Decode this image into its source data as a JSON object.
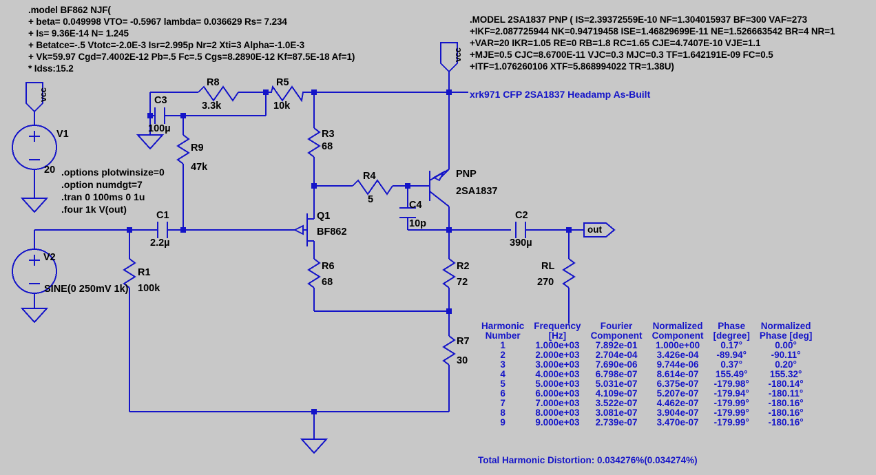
{
  "netlist": {
    "jfet_model": [
      ".model BF862 NJF(",
      "+ beta= 0.049998 VTO= -0.5967 lambda= 0.036629 Rs= 7.234",
      "+ Is= 9.36E-14 N= 1.245",
      "+ Betatce=-.5 Vtotc=-2.0E-3 Isr=2.995p Nr=2 Xti=3 Alpha=-1.0E-3",
      "+ Vk=59.97 Cgd=7.4002E-12 Pb=.5 Fc=.5 Cgs=8.2890E-12 Kf=87.5E-18 Af=1)",
      "* Idss:15.2"
    ],
    "pnp_model": [
      ".MODEL 2SA1837 PNP ( IS=2.39372559E-10 NF=1.304015937 BF=300 VAF=273",
      "+IKF=2.087725944 NK=0.94719458 ISE=1.46829699E-11 NE=1.526663542 BR=4 NR=1",
      "+VAR=20 IKR=1.05 RE=0 RB=1.8 RC=1.65 CJE=4.7407E-10 VJE=1.1",
      "+MJE=0.5 CJC=8.6700E-11 VJC=0.3 MJC=0.3 TF=1.642191E-09 FC=0.5",
      "+ITF=1.076260106 XTF=5.868994022 TR=1.38U)"
    ],
    "directives": [
      ".options plotwinsize=0",
      ".option numdgt=7",
      ".tran 0 100ms 0 1u",
      ".four 1k V(out)"
    ]
  },
  "title": "xrk971 CFP 2SA1837 Headamp As-Built",
  "colors": {
    "wire": "#1414c8",
    "text": "#000000",
    "title": "#1414c8",
    "background": "#c8c8c8"
  },
  "labels": {
    "vcc_top_left": "vcc",
    "vcc_top_right": "vcc",
    "out": "out"
  },
  "components": {
    "V1": {
      "ref": "V1",
      "value": "20"
    },
    "V2": {
      "ref": "V2",
      "value": "SINE(0 250mV 1k)"
    },
    "C3": {
      "ref": "C3",
      "value": "100µ"
    },
    "C1": {
      "ref": "C1",
      "value": "2.2µ"
    },
    "C4": {
      "ref": "C4",
      "value": "10p"
    },
    "C2": {
      "ref": "C2",
      "value": "390µ"
    },
    "R8": {
      "ref": "R8",
      "value": "3.3k"
    },
    "R5": {
      "ref": "R5",
      "value": "10k"
    },
    "R9": {
      "ref": "R9",
      "value": "47k"
    },
    "R3": {
      "ref": "R3",
      "value": "68"
    },
    "R4": {
      "ref": "R4",
      "value": "5"
    },
    "R1": {
      "ref": "R1",
      "value": "100k"
    },
    "R6": {
      "ref": "R6",
      "value": "68"
    },
    "R2": {
      "ref": "R2",
      "value": "72"
    },
    "R7": {
      "ref": "R7",
      "value": "30"
    },
    "RL": {
      "ref": "RL",
      "value": "270"
    },
    "Q1": {
      "ref": "Q1",
      "value": "BF862"
    },
    "Q2": {
      "ref": "PNP",
      "value": "2SA1837"
    }
  },
  "fourier": {
    "headers": [
      [
        "Harmonic",
        "Number"
      ],
      [
        "Frequency",
        "[Hz]"
      ],
      [
        "Fourier",
        "Component"
      ],
      [
        "Normalized",
        "Component"
      ],
      [
        "Phase",
        "[degree]"
      ],
      [
        "Normalized",
        "Phase [deg]"
      ]
    ],
    "rows": [
      [
        "1",
        "1.000e+03",
        "7.892e-01",
        "1.000e+00",
        "0.17°",
        "0.00°"
      ],
      [
        "2",
        "2.000e+03",
        "2.704e-04",
        "3.426e-04",
        "-89.94°",
        "-90.11°"
      ],
      [
        "3",
        "3.000e+03",
        "7.690e-06",
        "9.744e-06",
        "0.37°",
        "0.20°"
      ],
      [
        "4",
        "4.000e+03",
        "6.798e-07",
        "8.614e-07",
        "155.49°",
        "155.32°"
      ],
      [
        "5",
        "5.000e+03",
        "5.031e-07",
        "6.375e-07",
        "-179.98°",
        "-180.14°"
      ],
      [
        "6",
        "6.000e+03",
        "4.109e-07",
        "5.207e-07",
        "-179.94°",
        "-180.11°"
      ],
      [
        "7",
        "7.000e+03",
        "3.522e-07",
        "4.462e-07",
        "-179.99°",
        "-180.16°"
      ],
      [
        "8",
        "8.000e+03",
        "3.081e-07",
        "3.904e-07",
        "-179.99°",
        "-180.16°"
      ],
      [
        "9",
        "9.000e+03",
        "2.739e-07",
        "3.470e-07",
        "-179.99°",
        "-180.16°"
      ]
    ],
    "thd": "Total Harmonic Distortion: 0.034276%(0.034274%)"
  }
}
